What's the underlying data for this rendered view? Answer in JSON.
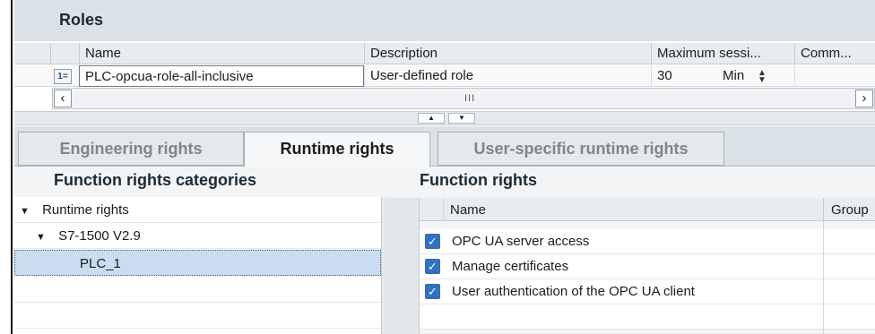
{
  "roles": {
    "title": "Roles",
    "columns": [
      "Name",
      "Description",
      "Maximum sessi...",
      "Comm..."
    ],
    "rows": [
      {
        "icon": "1=",
        "name": "PLC-opcua-role-all-inclusive",
        "description": "User-defined role",
        "max_session": "30",
        "unit": "Min"
      }
    ],
    "scroll_grip": "III"
  },
  "tabs": [
    {
      "label": "Engineering rights",
      "active": false
    },
    {
      "label": "Runtime rights",
      "active": true
    },
    {
      "label": "User-specific runtime rights",
      "active": false
    }
  ],
  "categories": {
    "title": "Function rights categories",
    "items": [
      {
        "label": "Runtime rights",
        "level": 0,
        "expanded": true
      },
      {
        "label": "S7-1500 V2.9",
        "level": 1,
        "expanded": true
      },
      {
        "label": "PLC_1",
        "level": 2,
        "selected": true
      }
    ]
  },
  "function_rights": {
    "title": "Function rights",
    "columns": [
      "Name",
      "Group"
    ],
    "rows": [
      {
        "name": "OPC UA server access",
        "checked": true
      },
      {
        "name": "Manage certificates",
        "checked": true
      },
      {
        "name": "User authentication of the OPC UA client",
        "checked": true
      }
    ]
  },
  "icons": {
    "expand": "chevron-down-icon",
    "checkbox": "checkbox-checked-icon",
    "scroll_left": "chevron-left-icon",
    "scroll_right": "chevron-right-icon",
    "spinner": "spinner-icon",
    "splitter_up": "chevron-up-icon",
    "splitter_down": "chevron-down-icon"
  },
  "colors": {
    "header_bg": "#dbe2e7",
    "selection": "#c9dcf0",
    "checkbox": "#2f72c4"
  }
}
